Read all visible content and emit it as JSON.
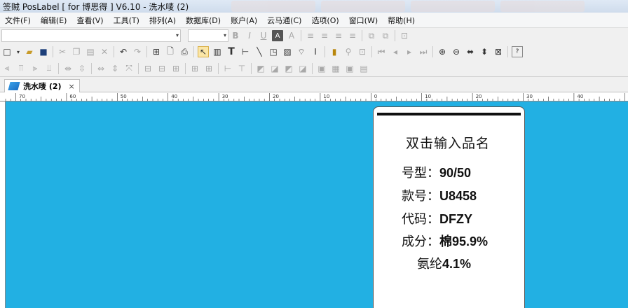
{
  "window": {
    "title": "签贼 PosLabel [ for 博思得 ]  V6.10  - 洗水唛 (2)"
  },
  "menu": {
    "items": [
      "文件(F)",
      "编辑(E)",
      "查看(V)",
      "工具(T)",
      "排列(A)",
      "数据库(D)",
      "账户(A)",
      "云马通(C)",
      "选项(O)",
      "窗口(W)",
      "帮助(H)"
    ]
  },
  "toolbar1": {
    "format_icons": [
      "B",
      "I",
      "U",
      "A",
      "A",
      "≡",
      "≡",
      "≡",
      "≡"
    ]
  },
  "toolbar2": {
    "text_tool": "T",
    "dropdown_glyph": "▾"
  },
  "document": {
    "tab_label": "洗水唛 (2)",
    "tab_close": "×"
  },
  "ruler": {
    "labels": [
      "70",
      "60",
      "50",
      "40",
      "30",
      "20",
      "10",
      "0",
      "10",
      "20",
      "30",
      "40"
    ]
  },
  "label": {
    "title": "双击输入品名",
    "rows": [
      {
        "key": "号型：",
        "value": "90/50"
      },
      {
        "key": "款号：",
        "value": "U8458"
      },
      {
        "key": "代码：",
        "value": "DFZY"
      },
      {
        "key": "成分：",
        "value": "棉95.9%"
      },
      {
        "key": "氨纶",
        "value": "4.1%"
      }
    ]
  },
  "colors": {
    "canvas": "#22b0e3",
    "label_bg": "#ffffff"
  }
}
